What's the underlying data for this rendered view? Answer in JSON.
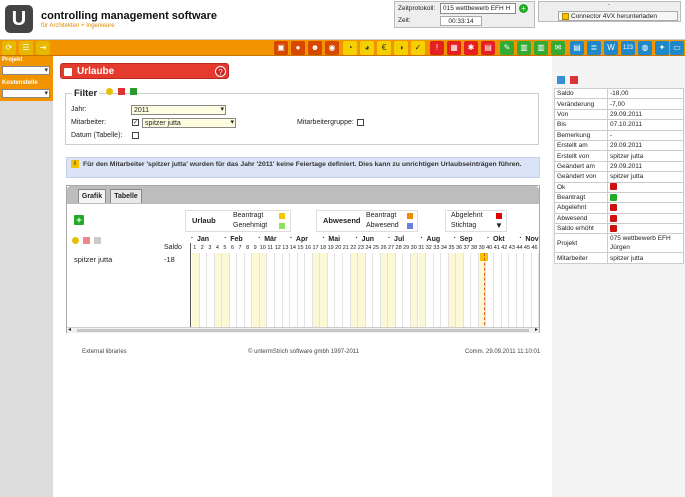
{
  "app": {
    "logo_letter": "U",
    "name": "controlling management software",
    "subtitle": "für Architekten + Ingenieure"
  },
  "zeitprotokoll": {
    "label": "Zeitprotokoll:",
    "project": "015 wettbewerb EFH H",
    "zeit_label": "Zeit:",
    "zeit_value": "00:33:14"
  },
  "connector": {
    "dot": "-",
    "label": "Connector 4VX herunterladen"
  },
  "left": {
    "projekt_label": "Projekt",
    "kostenstelle_label": "Kostenstelle"
  },
  "page": {
    "title": "Urlaube"
  },
  "filter": {
    "legend": "Filter",
    "jahr_label": "Jahr:",
    "jahr_value": "2011",
    "mitarbeiter_label": "Mitarbeiter:",
    "mitarbeiter_value": "spitzer jutta",
    "mitarbeitergruppe_label": "Mitarbeitergruppe:",
    "datum_label": "Datum (Tabelle):"
  },
  "info": {
    "text": "Für den Mitarbeiter 'spitzer jutta' wurden für das Jahr '2011' keine Feiertage definiert. Dies kann zu unrichtigen Urlaubseinträgen führen."
  },
  "tabs": {
    "grafik": "Grafik",
    "tabelle": "Tabelle"
  },
  "legend": {
    "urlaub": "Urlaub",
    "u_beantragt": "Beantragt",
    "u_genehmigt": "Genehmigt",
    "abwesend": "Abwesend",
    "a_beantragt": "Beantragt",
    "a_abwesend": "Abwesend",
    "abgelehnt": "Abgelehnt",
    "stichtag": "Stichtag",
    "colors": {
      "u_beantragt": "#f5c400",
      "u_genehmigt": "#8fe05a",
      "a_beantragt": "#f08a00",
      "a_abwesend": "#6a7fe0",
      "abgelehnt": "#e00000"
    }
  },
  "chart": {
    "saldo_header": "Saldo",
    "months": [
      "Jan",
      "Feb",
      "Mär",
      "Apr",
      "Mai",
      "Jun",
      "Jul",
      "Aug",
      "Sep",
      "Okt",
      "Nov"
    ],
    "weeks": [
      "1",
      "2",
      "3",
      "4",
      "5",
      "6",
      "7",
      "8",
      "9",
      "10",
      "11",
      "12",
      "13",
      "14",
      "15",
      "16",
      "17",
      "18",
      "19",
      "20",
      "21",
      "22",
      "23",
      "24",
      "25",
      "26",
      "27",
      "28",
      "29",
      "30",
      "31",
      "32",
      "33",
      "34",
      "35",
      "36",
      "37",
      "38",
      "39",
      "40",
      "41",
      "42",
      "43",
      "44",
      "45",
      "46"
    ],
    "person": "spitzer jutta",
    "saldo": "-18",
    "highlighted_weeks": [
      1,
      4,
      5,
      9,
      10,
      17,
      18,
      22,
      23,
      26,
      27,
      30,
      31,
      35,
      36,
      39
    ],
    "stichtag_week": 39
  },
  "footer": {
    "left": "External libraries",
    "mid": "© untermStrich software gmbh 1997-2011",
    "right": "Comm. 29.09.2011 11:10:01"
  },
  "props": [
    {
      "k": "Saldo",
      "v": "-18,00"
    },
    {
      "k": "Veränderung",
      "v": "-7,00"
    },
    {
      "k": "Von",
      "v": "29.09.2011"
    },
    {
      "k": "Bis",
      "v": "07.10.2011"
    },
    {
      "k": "Bemerkung",
      "v": "-"
    },
    {
      "k": "Erstellt am",
      "v": "29.09.2011"
    },
    {
      "k": "Erstellt von",
      "v": "spitzer jutta"
    },
    {
      "k": "Geändert am",
      "v": "29.09.2011"
    },
    {
      "k": "Geändert von",
      "v": "spitzer jutta"
    },
    {
      "k": "Ok",
      "v": "",
      "status": "#cc1111"
    },
    {
      "k": "Beantragt",
      "v": "",
      "status": "#22aa22"
    },
    {
      "k": "Abgelehnt",
      "v": "",
      "status": "#cc1111"
    },
    {
      "k": "Abwesend",
      "v": "",
      "status": "#cc1111"
    },
    {
      "k": "Saldo erhöht",
      "v": "",
      "status": "#cc1111"
    },
    {
      "k": "Projekt",
      "v": "075 wettbewerb EFH Jürgen"
    },
    {
      "k": "Mitarbeiter",
      "v": "spitzer jutta"
    }
  ]
}
